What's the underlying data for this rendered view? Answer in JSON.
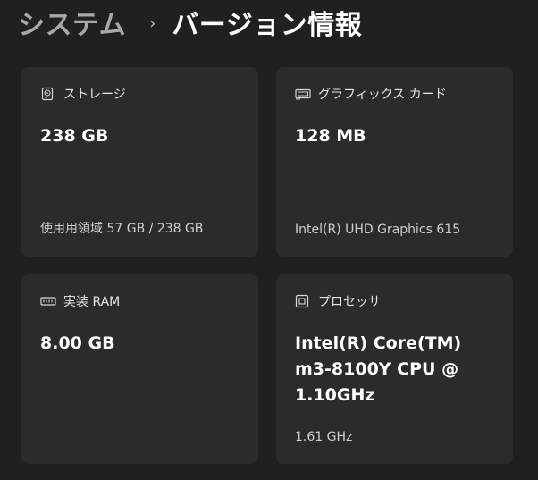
{
  "breadcrumb": {
    "parent": "システム",
    "separator": "›",
    "current": "バージョン情報"
  },
  "cards": {
    "storage": {
      "icon": "storage-icon",
      "label": "ストレージ",
      "value": "238 GB",
      "detail": "使用用領域 57 GB / 238 GB"
    },
    "gpu": {
      "icon": "graphics-card-icon",
      "label": "グラフィックス カード",
      "value": "128 MB",
      "detail": "Intel(R) UHD Graphics 615"
    },
    "ram": {
      "icon": "memory-icon",
      "label": "実装 RAM",
      "value": "8.00 GB",
      "detail": ""
    },
    "cpu": {
      "icon": "processor-icon",
      "label": "プロセッサ",
      "value": "Intel(R) Core(TM) m3-8100Y CPU @ 1.10GHz",
      "detail": "1.61 GHz"
    }
  },
  "colors": {
    "background": "#202020",
    "card": "#2b2b2b",
    "text_primary": "#ffffff",
    "text_secondary": "#cfcfcf",
    "breadcrumb_parent": "#a8a8a8"
  }
}
